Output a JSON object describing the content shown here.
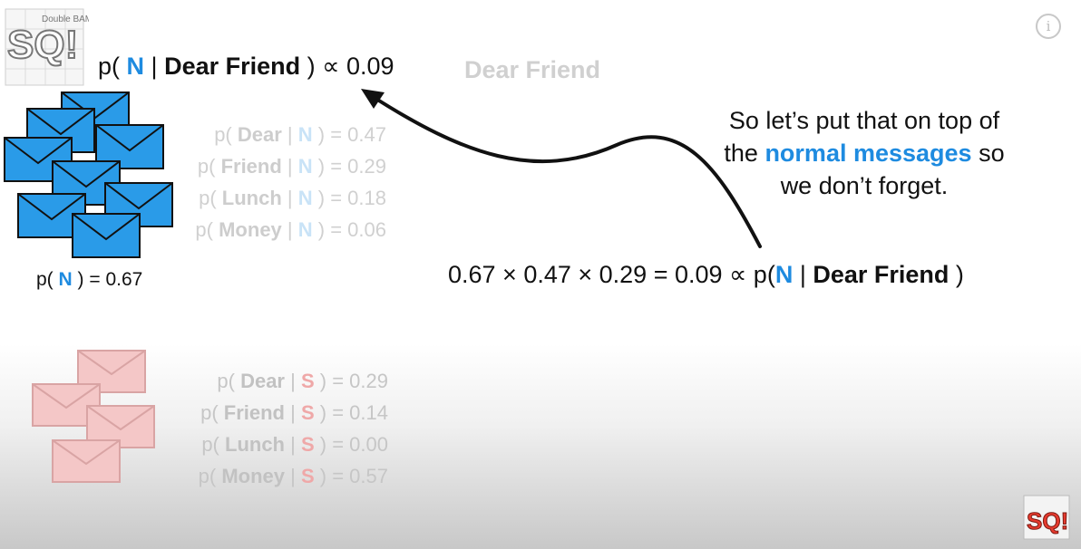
{
  "logo": {
    "main": "SQ!",
    "tagline": "Double BAM!!"
  },
  "corner_logo": {
    "text": "SQ!"
  },
  "info_icon": "info-circle-icon",
  "title": {
    "open": "p(",
    "class": "N",
    "sep": "|",
    "words": "Dear Friend",
    "close": ")",
    "prop": "∝ 0.09"
  },
  "ghost_phrase": "Dear Friend",
  "normal_probs": [
    {
      "open": "p(",
      "word": "Dear",
      "sep": "|",
      "cls": "N",
      "rest": ") = 0.47"
    },
    {
      "open": "p(",
      "word": "Friend",
      "sep": "|",
      "cls": "N",
      "rest": ") = 0.29"
    },
    {
      "open": "p(",
      "word": "Lunch",
      "sep": "|",
      "cls": "N",
      "rest": ") = 0.18"
    },
    {
      "open": "p(",
      "word": "Money",
      "sep": "|",
      "cls": "N",
      "rest": ") = 0.06"
    }
  ],
  "prior_n": {
    "open": "p(",
    "cls": "N",
    "rest": ") = 0.67"
  },
  "spam_probs": [
    {
      "open": "p(",
      "word": "Dear",
      "sep": "|",
      "cls": "S",
      "rest": ") = 0.29"
    },
    {
      "open": "p(",
      "word": "Friend",
      "sep": "|",
      "cls": "S",
      "rest": ") = 0.14"
    },
    {
      "open": "p(",
      "word": "Lunch",
      "sep": "|",
      "cls": "S",
      "rest": ") = 0.00"
    },
    {
      "open": "p(",
      "word": "Money",
      "sep": "|",
      "cls": "S",
      "rest": ") = 0.57"
    }
  ],
  "callout": {
    "line1": "So let’s put that on top of",
    "pre2": "the",
    "highlight": "normal messages",
    "post2": "so",
    "line3": "we don’t forget."
  },
  "equation": {
    "calc": "0.67 × 0.47 × 0.29 = 0.09 ∝ p(",
    "cls": "N",
    "sep": "|",
    "words": "Dear Friend",
    "close": ")"
  },
  "colors": {
    "normal_blue": "#1e8be0",
    "envelope_blue": "#2a9be8",
    "spam_pink": "#f4c7c7"
  }
}
